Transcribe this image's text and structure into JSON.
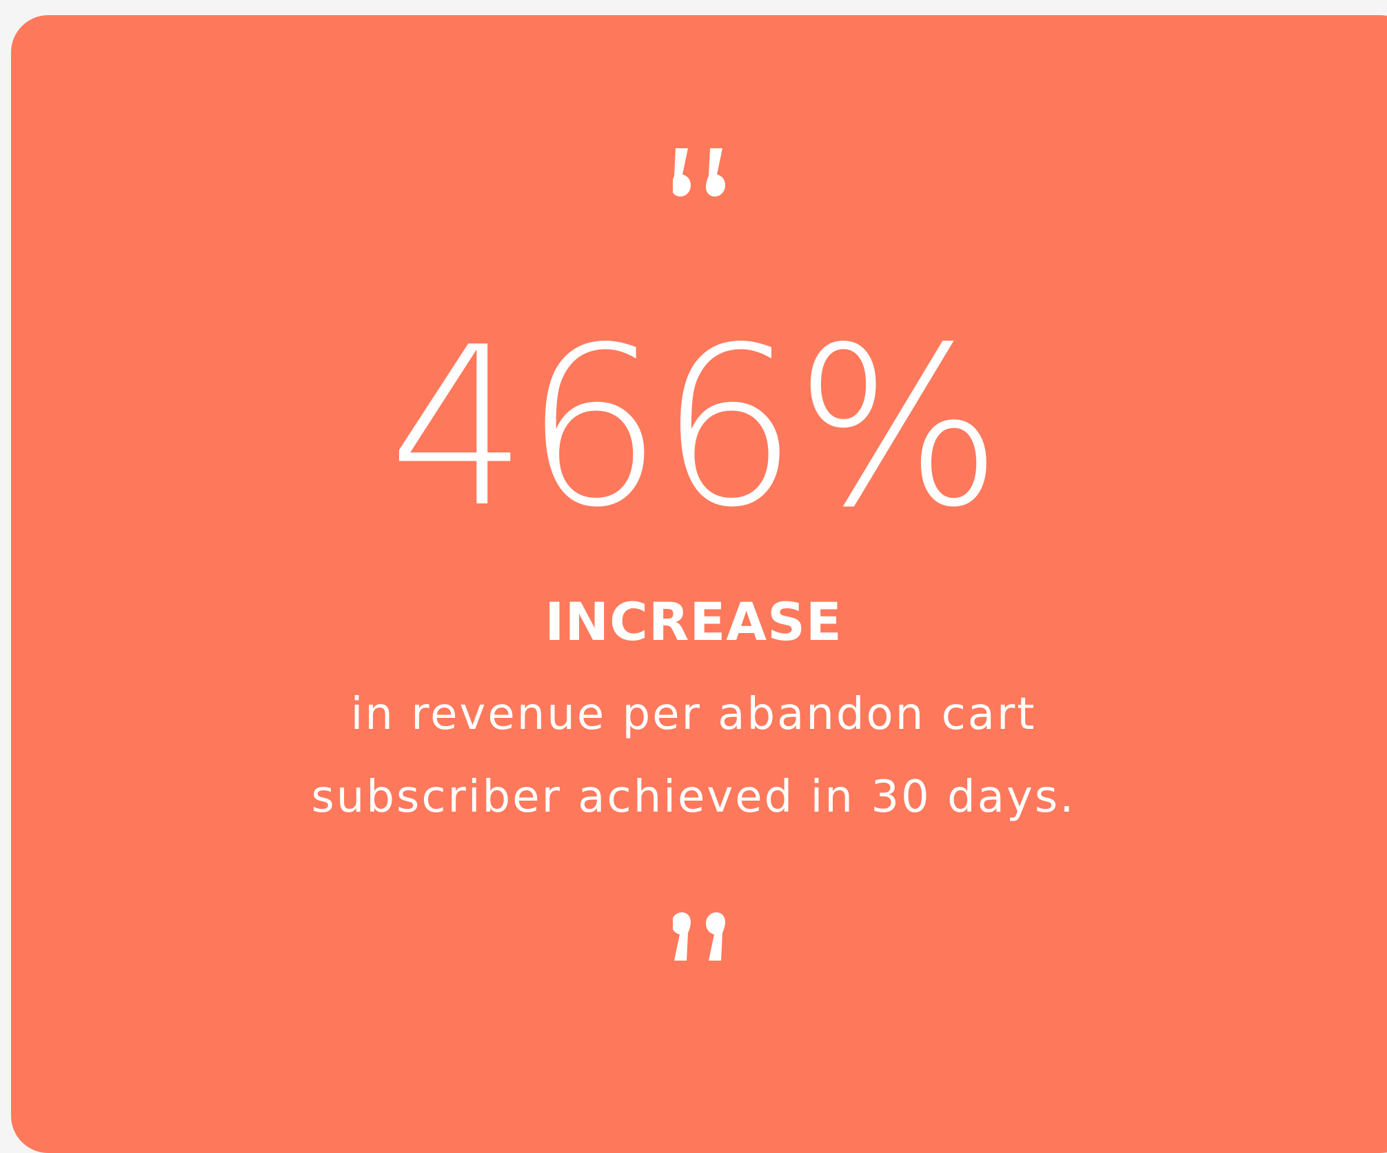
{
  "card": {
    "background_color": "#fe785b",
    "text_color": "#ffffff",
    "statistic": "466%",
    "label": "INCREASE",
    "description_lines": [
      "in revenue per abandon cart",
      "subscriber achieved in 30 days."
    ],
    "icons": {
      "open_quote": "open-quote-icon",
      "close_quote": "close-quote-icon"
    }
  }
}
